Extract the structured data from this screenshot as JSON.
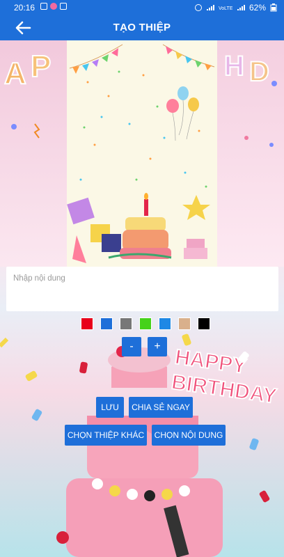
{
  "status_bar": {
    "time": "20:16",
    "battery": "62%"
  },
  "header": {
    "title": "TẠO THIỆP"
  },
  "background": {
    "happy_text": "HAPPY",
    "birthday_text": "BIRTHDAY"
  },
  "input": {
    "placeholder": "Nhập nội dung",
    "value": ""
  },
  "colors": [
    "#e8001a",
    "#1e6fd9",
    "#777777",
    "#46d21a",
    "#1e88e5",
    "#d9b08c",
    "#000000"
  ],
  "size_controls": {
    "decrease": "-",
    "increase": "+"
  },
  "actions": {
    "save": "LƯU",
    "share": "CHIA SẺ NGAY",
    "choose_card": "CHỌN THIỆP KHÁC",
    "choose_content": "CHỌN NỘI DUNG"
  },
  "accent": "#1e6fd9"
}
